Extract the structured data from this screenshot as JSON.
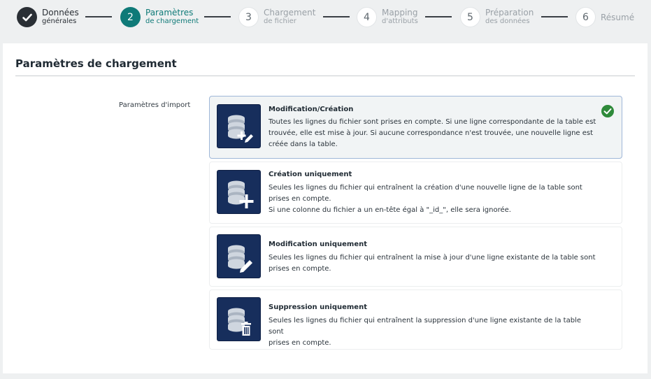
{
  "stepper": {
    "steps": [
      {
        "number": "",
        "title": "Données",
        "sub": "générales",
        "state": "done"
      },
      {
        "number": "2",
        "title": "Paramètres",
        "sub": "de chargement",
        "state": "active"
      },
      {
        "number": "3",
        "title": "Chargement",
        "sub": "de fichier",
        "state": "pending"
      },
      {
        "number": "4",
        "title": "Mapping",
        "sub": "d'attributs",
        "state": "pending"
      },
      {
        "number": "5",
        "title": "Préparation",
        "sub": "des données",
        "state": "pending"
      },
      {
        "number": "6",
        "title": "Résumé",
        "sub": "",
        "state": "pending"
      }
    ]
  },
  "panel": {
    "title": "Paramètres de chargement",
    "field_label": "Paramètres d'import"
  },
  "options": [
    {
      "title": "Modification/Création",
      "lines": [
        "Toutes les lignes du fichier sont prises en compte. Si une ligne correspondante de la table est",
        "trouvée, elle est mise à jour. Si aucune correspondance n'est trouvée, une nouvelle ligne est",
        "créée dans la table."
      ],
      "icon": "database-edit-add-icon",
      "selected": true
    },
    {
      "title": "Création uniquement",
      "lines": [
        "Seules les lignes du fichier qui entraînent la création d'une nouvelle ligne de la table sont",
        "prises en compte.",
        "Si une colonne du fichier a un en-tête égal à \"_id_\", elle sera ignorée."
      ],
      "icon": "database-add-icon",
      "selected": false
    },
    {
      "title": "Modification uniquement",
      "lines": [
        "Seules les lignes du fichier qui entraînent la mise à jour d'une ligne existante de la table sont",
        "prises en compte."
      ],
      "icon": "database-edit-icon",
      "selected": false
    },
    {
      "title": "Suppression uniquement",
      "lines": [
        "Seules les lignes du fichier qui entraînent la suppression d'une ligne existante de la table sont",
        "prises en compte."
      ],
      "icon": "database-delete-icon",
      "selected": false
    }
  ],
  "colors": {
    "accent": "#0f7a78",
    "icon_bg": "#172e5c",
    "check": "#2e8a3a"
  }
}
